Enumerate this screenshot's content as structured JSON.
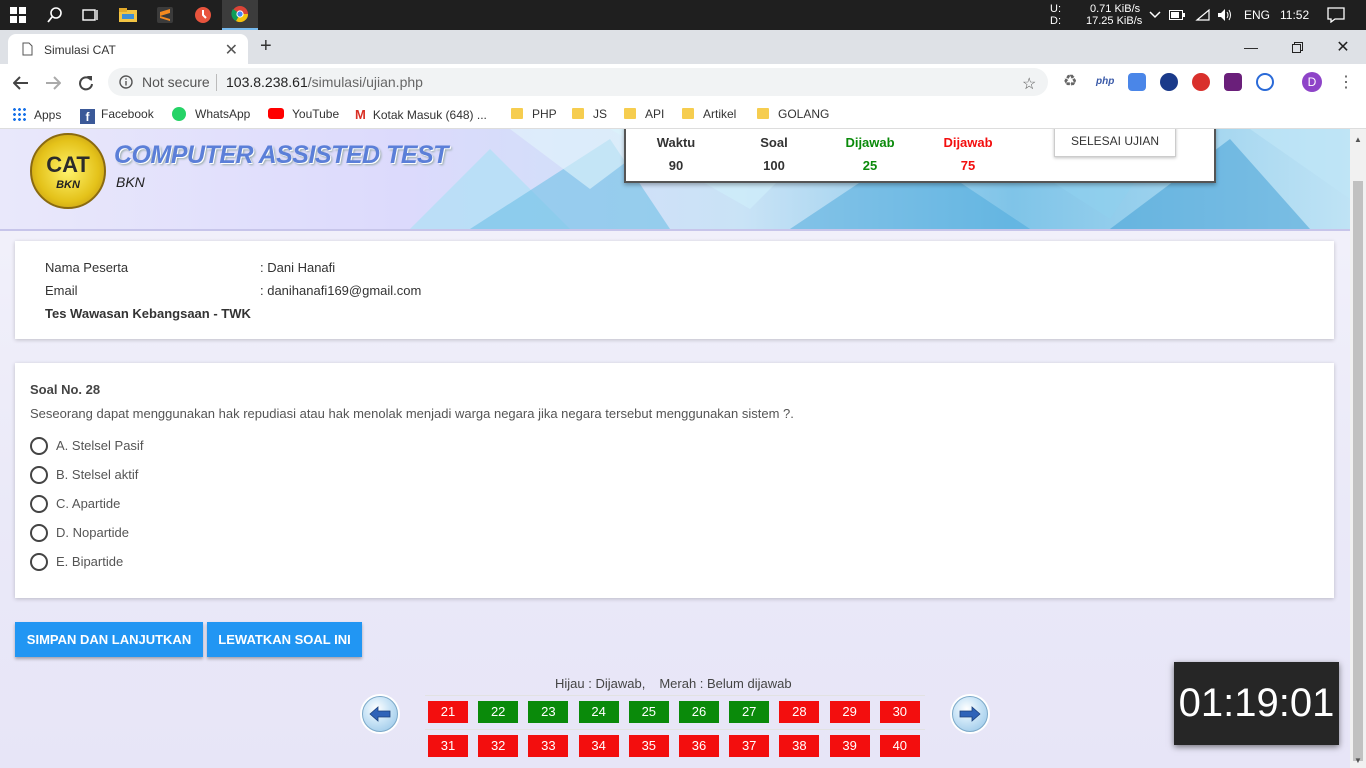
{
  "taskbar": {
    "network_up_label": "U:",
    "network_down_label": "D:",
    "network_up": "0.71 KiB/s",
    "network_down": "17.25 KiB/s",
    "language": "ENG",
    "time": "11:52"
  },
  "browser": {
    "tab_title": "Simulasi CAT",
    "security": "Not secure",
    "url_host": "103.8.238.61",
    "url_path": "/simulasi/ujian.php",
    "profile_initial": "D",
    "ext_php_label": "php"
  },
  "bookmarks": [
    {
      "label": "Apps",
      "icon": "apps-grid-icon"
    },
    {
      "label": "Facebook",
      "icon": "facebook-icon"
    },
    {
      "label": "WhatsApp",
      "icon": "whatsapp-icon"
    },
    {
      "label": "YouTube",
      "icon": "youtube-icon"
    },
    {
      "label": "Kotak Masuk (648) ...",
      "icon": "gmail-icon"
    },
    {
      "label": "PHP",
      "icon": "folder-icon"
    },
    {
      "label": "JS",
      "icon": "folder-icon"
    },
    {
      "label": "API",
      "icon": "folder-icon"
    },
    {
      "label": "Artikel",
      "icon": "folder-icon"
    },
    {
      "label": "GOLANG",
      "icon": "folder-icon"
    }
  ],
  "header": {
    "logo_text": "CAT",
    "logo_sub": "BKN",
    "title": "COMPUTER ASSISTED TEST",
    "subtitle": "BKN"
  },
  "stats": {
    "waktu_label": "Waktu",
    "waktu_value": "90",
    "soal_label": "Soal",
    "soal_value": "100",
    "dijawab_label": "Dijawab",
    "dijawab_value": "25",
    "belum_label": "Dijawab",
    "belum_value": "75",
    "finish_button": "SELESAI UJIAN",
    "colors": {
      "answered": "#0a8a0a",
      "unanswered": "#f30e0e"
    }
  },
  "participant": {
    "name_label": "Nama Peserta",
    "name_value": ": Dani Hanafi",
    "email_label": "Email",
    "email_value": ": danihanafi169@gmail.com",
    "test_name": "Tes Wawasan Kebangsaan - TWK"
  },
  "question": {
    "number": "Soal No. 28",
    "text": "Seseorang dapat menggunakan hak repudiasi atau hak menolak menjadi warga negara jika negara tersebut menggunakan sistem ?.",
    "options": [
      "A. Stelsel Pasif",
      "B. Stelsel aktif",
      "C. Apartide",
      "D. Nopartide",
      "E. Bipartide"
    ]
  },
  "actions": {
    "save_next": "SIMPAN DAN LANJUTKAN",
    "skip": "LEWATKAN SOAL INI"
  },
  "legend": {
    "green": "Hijau : Dijawab,",
    "red": "Merah : Belum dijawab"
  },
  "navigator": {
    "row1": [
      {
        "n": "21",
        "status": "red"
      },
      {
        "n": "22",
        "status": "green"
      },
      {
        "n": "23",
        "status": "green"
      },
      {
        "n": "24",
        "status": "green"
      },
      {
        "n": "25",
        "status": "green"
      },
      {
        "n": "26",
        "status": "green"
      },
      {
        "n": "27",
        "status": "green"
      },
      {
        "n": "28",
        "status": "red"
      },
      {
        "n": "29",
        "status": "red"
      },
      {
        "n": "30",
        "status": "red"
      }
    ],
    "row2": [
      {
        "n": "31",
        "status": "red"
      },
      {
        "n": "32",
        "status": "red"
      },
      {
        "n": "33",
        "status": "red"
      },
      {
        "n": "34",
        "status": "red"
      },
      {
        "n": "35",
        "status": "red"
      },
      {
        "n": "36",
        "status": "red"
      },
      {
        "n": "37",
        "status": "red"
      },
      {
        "n": "38",
        "status": "red"
      },
      {
        "n": "39",
        "status": "red"
      },
      {
        "n": "40",
        "status": "red"
      }
    ]
  },
  "timer": "01:19:01"
}
